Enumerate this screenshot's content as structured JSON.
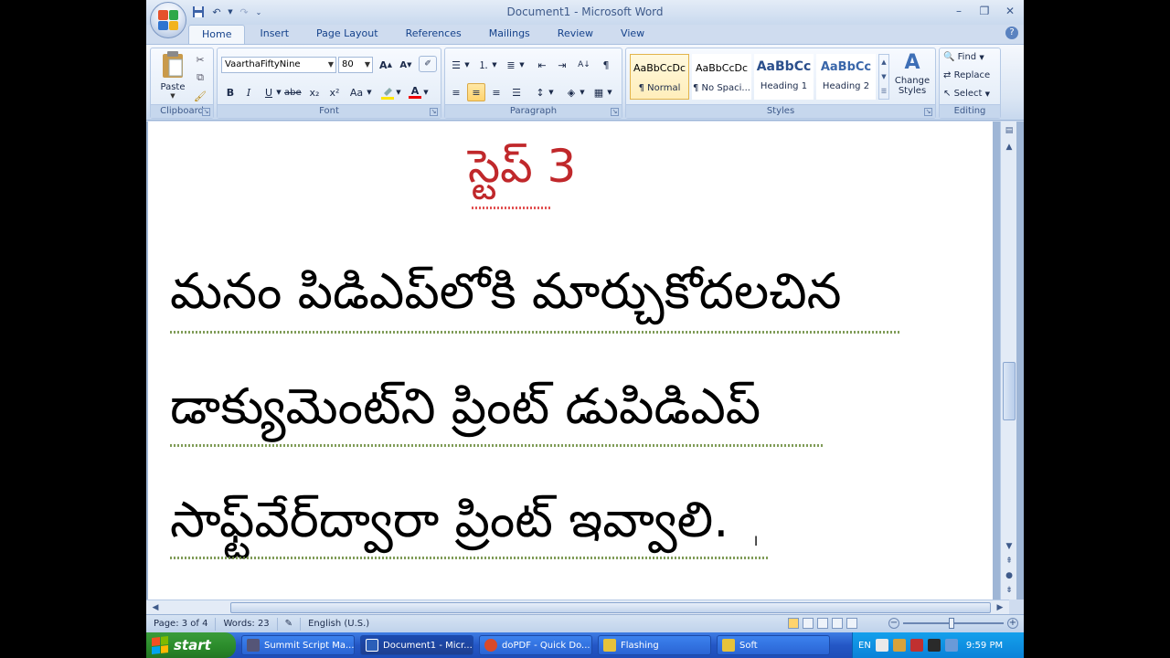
{
  "window": {
    "title": "Document1 - Microsoft Word"
  },
  "tabs": [
    {
      "label": "Home",
      "active": true
    },
    {
      "label": "Insert"
    },
    {
      "label": "Page Layout"
    },
    {
      "label": "References"
    },
    {
      "label": "Mailings"
    },
    {
      "label": "Review"
    },
    {
      "label": "View"
    }
  ],
  "ribbon": {
    "clipboard": {
      "label": "Clipboard",
      "paste_label": "Paste"
    },
    "font": {
      "label": "Font",
      "font_name": "VaarthaFiftyNine",
      "font_size": "80",
      "bold": "B",
      "italic": "I",
      "underline": "U",
      "strike": "abe",
      "subscript": "x₂",
      "superscript": "x²",
      "change_case": "Aa"
    },
    "paragraph": {
      "label": "Paragraph"
    },
    "styles": {
      "label": "Styles",
      "items": [
        {
          "sample": "AaBbCcDc",
          "name": "¶ Normal",
          "selected": true
        },
        {
          "sample": "AaBbCcDc",
          "name": "¶ No Spaci..."
        },
        {
          "sample": "AaBbCc",
          "name": "Heading 1"
        },
        {
          "sample": "AaBbCc",
          "name": "Heading 2"
        }
      ],
      "change_styles": "Change Styles"
    },
    "editing": {
      "label": "Editing",
      "find": "Find",
      "replace": "Replace",
      "select": "Select"
    }
  },
  "document": {
    "heading": "స్టెప్ 3",
    "lines": [
      "మనం పిడిఎప్‌లోకి మార్చుకోదలచిన",
      "డాక్యుమెంట్‌ని ప్రింట్ డుపిడిఎప్",
      "సాఫ్ట్‌వేర్‌ద్వారా ప్రింట్ ఇవ్వాలి."
    ]
  },
  "statusbar": {
    "page": "Page: 3 of 4",
    "words": "Words: 23",
    "language": "English (U.S.)"
  },
  "taskbar": {
    "start": "start",
    "tasks": [
      {
        "label": "Summit Script Ma...",
        "color": "#555577"
      },
      {
        "label": "Document1 - Micr...",
        "color": "#2b5fb8",
        "active": true
      },
      {
        "label": "doPDF - Quick Do...",
        "color": "#d84a2a"
      },
      {
        "label": "Flashing",
        "color": "#e6c23a"
      },
      {
        "label": "Soft",
        "color": "#e6c23a"
      }
    ],
    "tray_lang": "EN",
    "clock": "9:59 PM"
  },
  "colors": {
    "heading_red": "#c0282b",
    "ribbon_blue": "#15428b",
    "taskbar_blue": "#2457c6",
    "start_green": "#2a8a2a"
  }
}
